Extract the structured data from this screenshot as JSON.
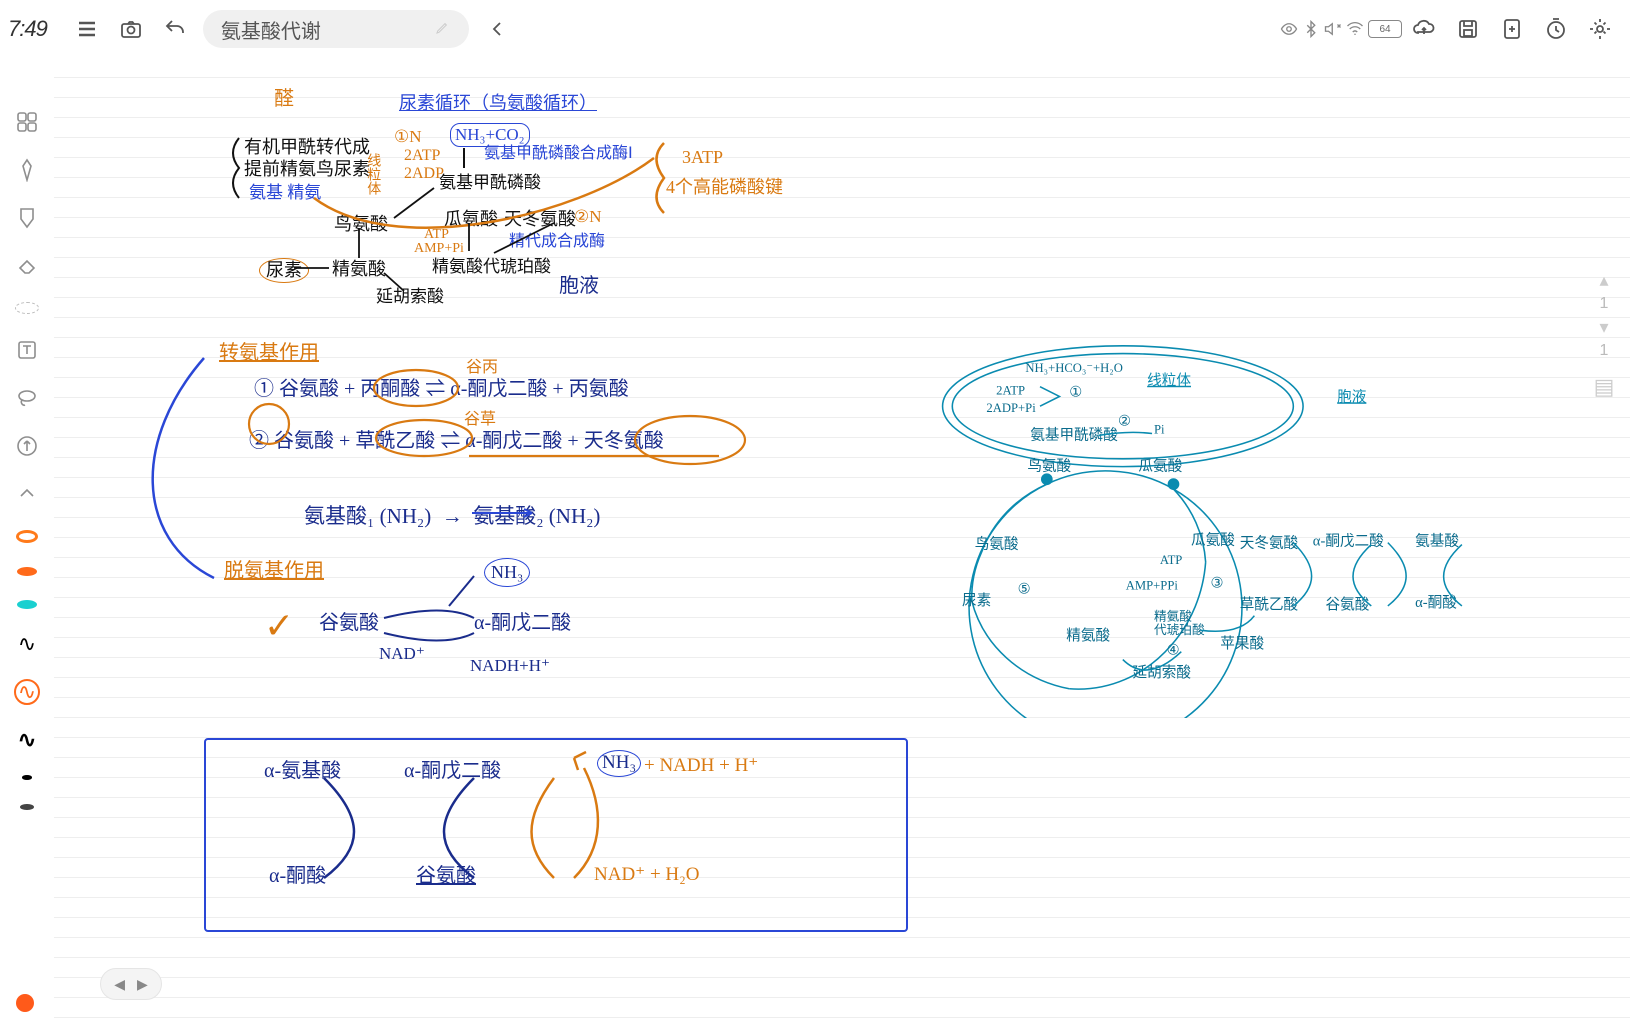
{
  "status": {
    "clock": "7:49",
    "battery_text": "64"
  },
  "header": {
    "title": "氨基酸代谢"
  },
  "page_indicator": {
    "top_number": "1",
    "bottom_number": "1"
  },
  "hw": {
    "top_small_orange": "醛",
    "urea_title": "尿素循环（鸟氨酸循环）",
    "list1": "有机甲酰转代成",
    "list2": "提前精氨鸟尿素",
    "nh3co2": "NH₃+CO₂",
    "on_label": "①N",
    "atp_2": "2ATP",
    "adp_2": "2ADP",
    "enzyme1": "氨基甲酰磷酸合成酶Ⅰ",
    "cp": "氨基甲酰磷酸",
    "mito_label": "线粒体",
    "ornate_left_blue": "氨基 精氨",
    "orn": "鸟氨酸",
    "cit": "瓜氨酸",
    "asp": "天冬氨酸",
    "on2": "②N",
    "atp": "ATP",
    "amp": "AMP+Pi",
    "argsuc": "精氨酸代琥珀酸",
    "syn": "精代成合成酶",
    "arg": "精氨酸",
    "urea": "尿素",
    "fum": "延胡索酸",
    "cell": "胞液",
    "brace1": "3ATP",
    "brace2": "4个高能磷酸键",
    "trans_title": "转氨基作用",
    "trans_sub1": "谷丙",
    "trans_line1a": "① 谷氨酸 + 丙酮酸 ⇌ α-酮戊二酸 + 丙氨酸",
    "trans_sub2": "谷草",
    "trans_line2a": "② 谷氨酸 + 草酰乙酸 ⇌ α-酮戊二酸 + 天冬氨酸",
    "chain": "氨基酸₁ (NH₂)  →  氨基酸₂ (NH₂)",
    "deam_title": "脱氨基作用",
    "check": "✓",
    "deam_src": "谷氨酸",
    "deam_prod": "α-酮戊二酸",
    "deam_nh3": "NH₃",
    "nad": "NAD⁺",
    "nadhhh": "NADH+H⁺",
    "box_l1a": "α-氨基酸",
    "box_l1b": "α-酮戊二酸",
    "box_r1": "NH₃ + NADH + H⁺",
    "box_l2a": "α-酮酸",
    "box_l2b": "谷氨酸",
    "box_r2": "NAD⁺ + H₂O"
  },
  "diagram": {
    "top_eq": "NH₃+HCO₃⁻+H₂O",
    "atp2": "2ATP",
    "adp2": "2ADP+Pi",
    "step1": "①",
    "mito": "线粒体",
    "cyt": "胞液",
    "cp": "氨基甲酰磷酸",
    "step2": "②",
    "pi": "Pi",
    "orn": "鸟氨酸",
    "cit": "瓜氨酸",
    "orn2": "鸟氨酸",
    "cit2": "瓜氨酸",
    "asp": "天冬氨酸",
    "akg": "α-酮戊二酸",
    "aa": "氨基酸",
    "atp": "ATP",
    "amp": "AMP+PPi",
    "step3": "③",
    "argsuc": "精氨酸\n代琥珀酸",
    "oa": "草酰乙酸",
    "glu": "谷氨酸",
    "aket": "α-酮酸",
    "step4": "④",
    "malate": "苹果酸",
    "arg": "精氨酸",
    "urea": "尿素",
    "step5": "⑤",
    "fum": "延胡索酸"
  }
}
